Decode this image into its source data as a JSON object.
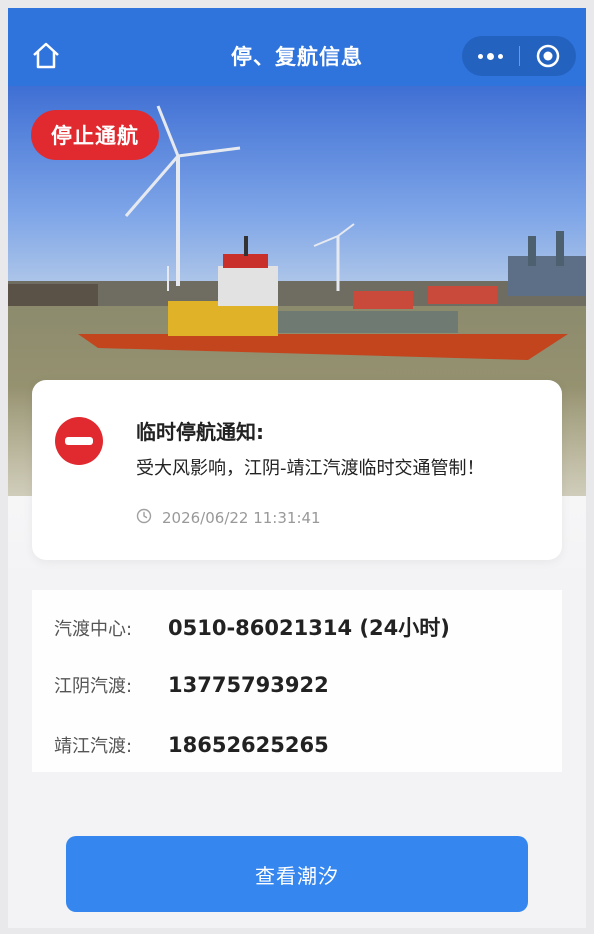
{
  "navbar": {
    "title": "停、复航信息",
    "home_icon": "home-icon",
    "more_icon": "more-dots-icon",
    "close_icon": "record-circle-icon",
    "color": "#2f74dc"
  },
  "status": {
    "label": "停止通航",
    "color": "#e02a2f"
  },
  "notice": {
    "icon": "no-entry-icon",
    "title": "临时停航通知:",
    "message": "受大风影响，江阴-靖江汽渡临时交通管制！",
    "time_icon": "clock-icon",
    "timestamp": "2026/06/22 11:31:41"
  },
  "contacts": [
    {
      "label": "汽渡中心:",
      "value": "0510-86021314 (24小时)"
    },
    {
      "label": "江阴汽渡:",
      "value": "13775793922"
    },
    {
      "label": "靖江汽渡:",
      "value": "18652625265"
    }
  ],
  "tide_button": {
    "label": "查看潮汐",
    "color": "#3587ef"
  }
}
